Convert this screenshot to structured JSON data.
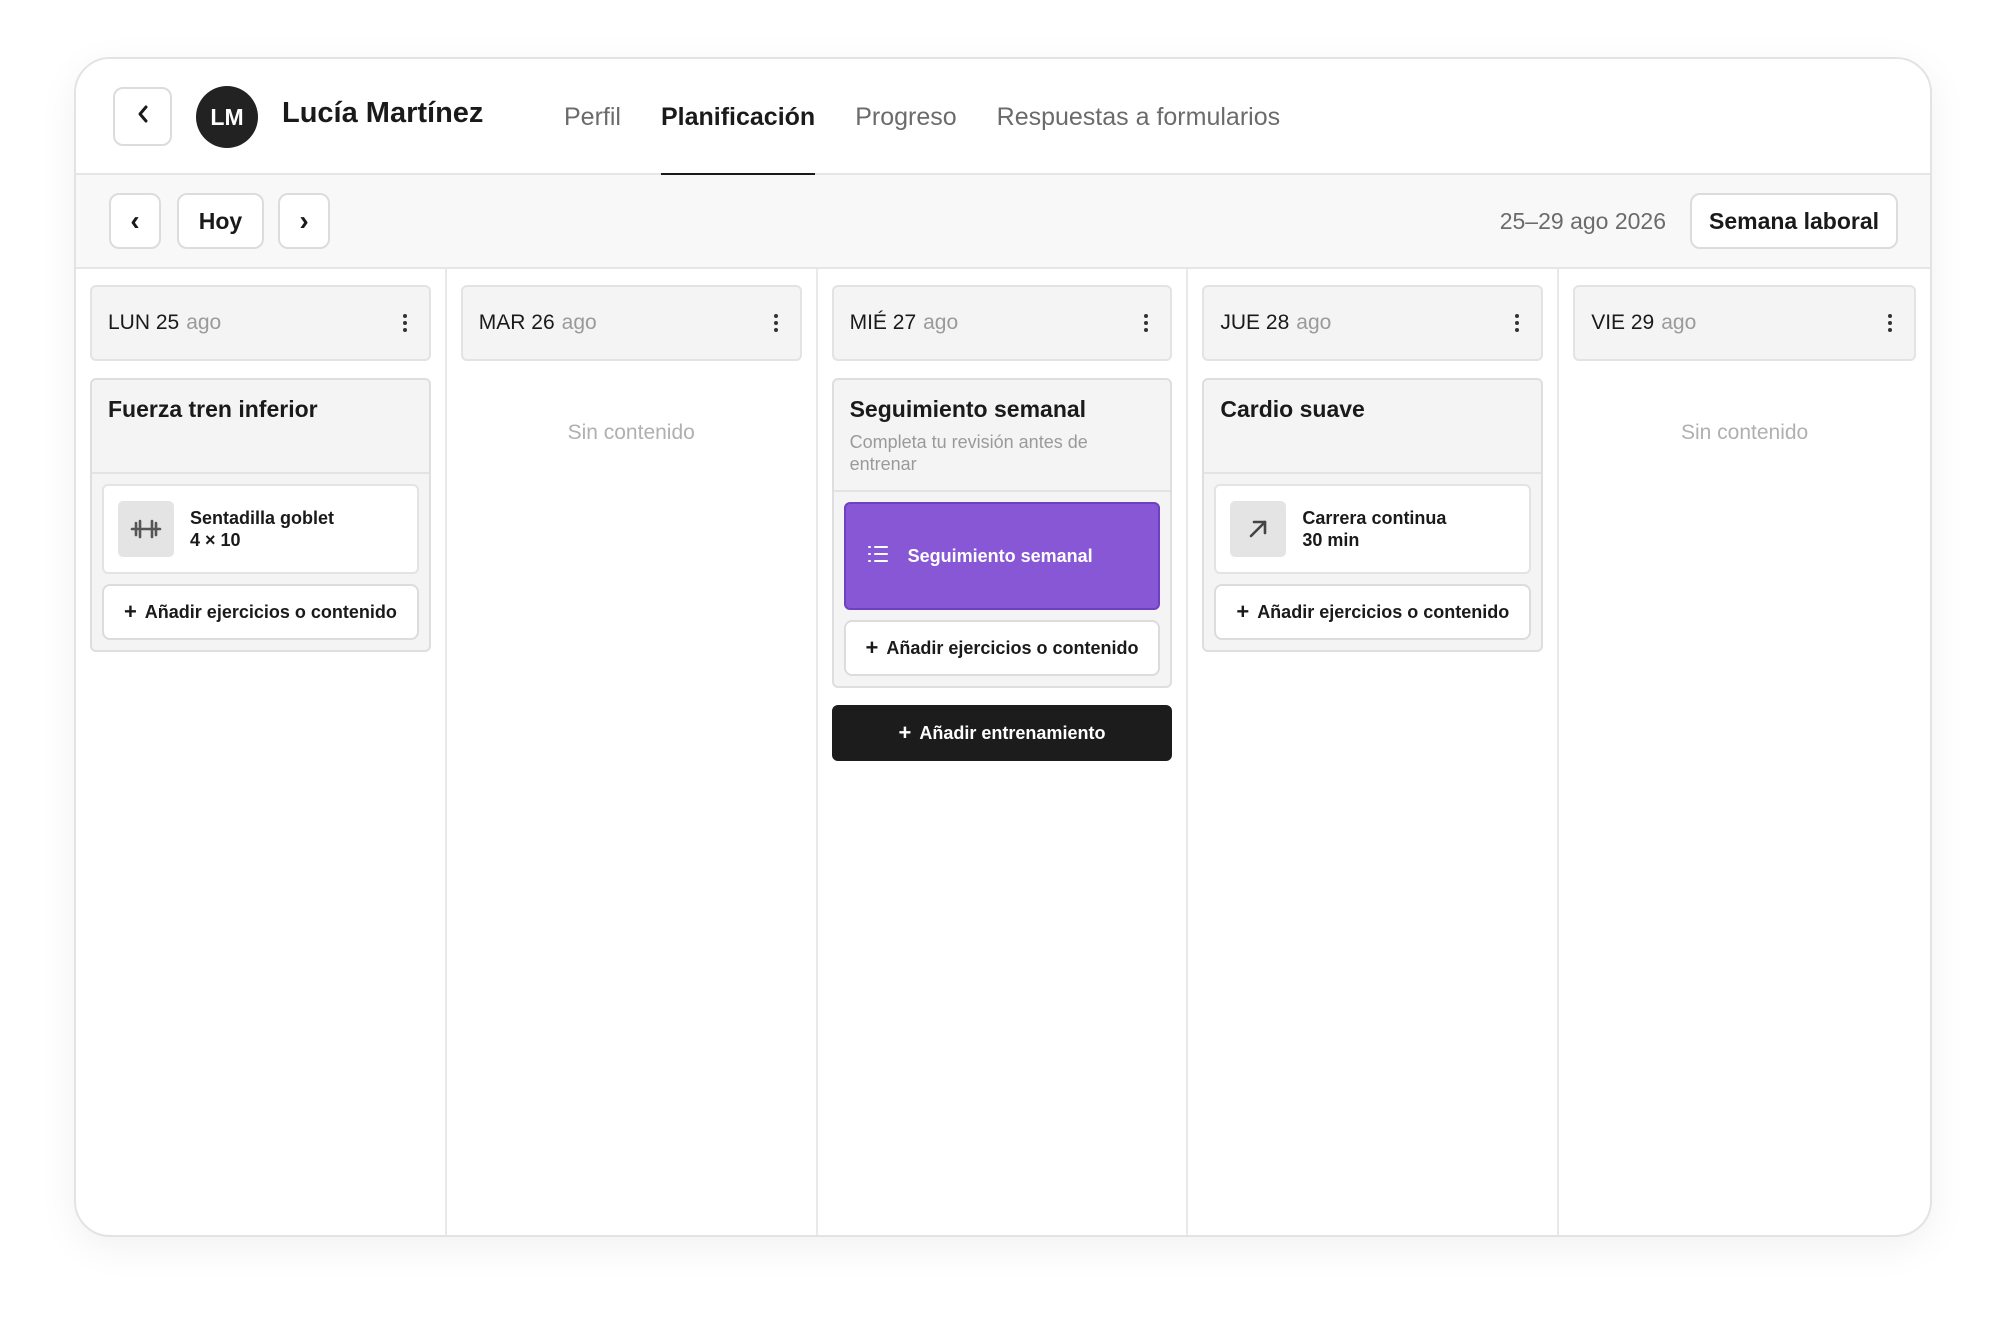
{
  "client": {
    "initials": "LM",
    "name": "Lucía Martínez"
  },
  "tabs": [
    {
      "label": "Perfil",
      "active": false
    },
    {
      "label": "Planificación",
      "active": true
    },
    {
      "label": "Progreso",
      "active": false
    },
    {
      "label": "Respuestas a formularios",
      "active": false
    }
  ],
  "toolbar": {
    "prev_label": "‹",
    "today_label": "Hoy",
    "next_label": "›",
    "date_range": "25–29 ago 2026",
    "view_label": "Semana laboral"
  },
  "days": [
    {
      "name": "LUN 25",
      "month": "ago",
      "workout": {
        "title": "Fuerza tren inferior",
        "exercise": {
          "icon": "dumbbell-icon",
          "name": "Sentadilla goblet",
          "detail": "4 × 10"
        },
        "add_label": "Añadir ejercicios o contenido"
      }
    },
    {
      "name": "MAR 26",
      "month": "ago",
      "empty_label": "Sin contenido"
    },
    {
      "name": "MIÉ 27",
      "month": "ago",
      "workout": {
        "title": "Seguimiento semanal",
        "subtitle": "Completa tu revisión antes de entrenar",
        "form": {
          "icon": "list-icon",
          "label": "Seguimiento semanal"
        },
        "add_label": "Añadir ejercicios o contenido"
      },
      "add_workout_label": "Añadir entrenamiento"
    },
    {
      "name": "JUE 28",
      "month": "ago",
      "workout": {
        "title": "Cardio suave",
        "exercise": {
          "icon": "arrow-up-right-icon",
          "name": "Carrera continua",
          "detail": "30 min"
        },
        "add_label": "Añadir ejercicios o contenido"
      }
    },
    {
      "name": "VIE 29",
      "month": "ago",
      "empty_label": "Sin contenido"
    }
  ],
  "colors": {
    "accent_purple": "#8757d6",
    "dark_button": "#1c1c1c"
  }
}
